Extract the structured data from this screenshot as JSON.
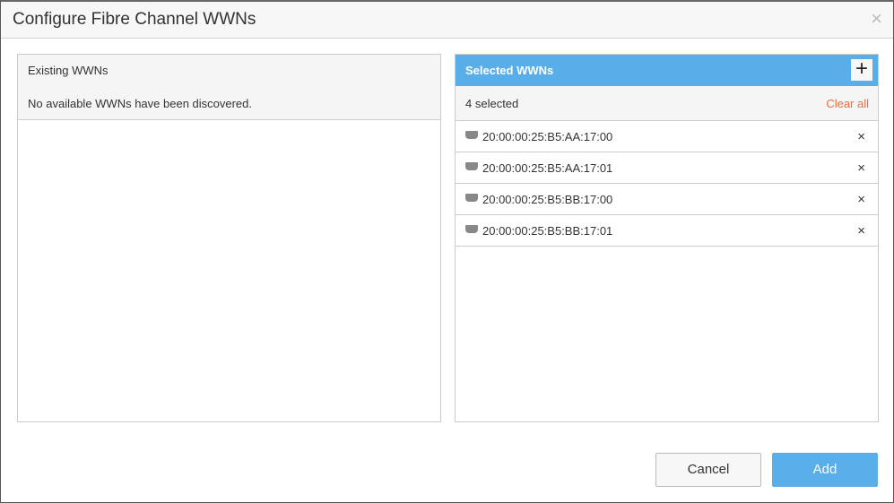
{
  "dialog": {
    "title": "Configure Fibre Channel WWNs",
    "close_icon": "×"
  },
  "existing": {
    "title": "Existing WWNs",
    "message": "No available WWNs have been discovered."
  },
  "selected": {
    "title": "Selected WWNs",
    "add_icon": "+",
    "count": "4 selected",
    "clear_all": "Clear all",
    "header_color": "#58aee9",
    "items": [
      {
        "wwn": "20:00:00:25:B5:AA:17:00"
      },
      {
        "wwn": "20:00:00:25:B5:AA:17:01"
      },
      {
        "wwn": "20:00:00:25:B5:BB:17:00"
      },
      {
        "wwn": "20:00:00:25:B5:BB:17:01"
      }
    ],
    "remove_icon": "×"
  },
  "buttons": {
    "cancel": "Cancel",
    "add": "Add"
  }
}
